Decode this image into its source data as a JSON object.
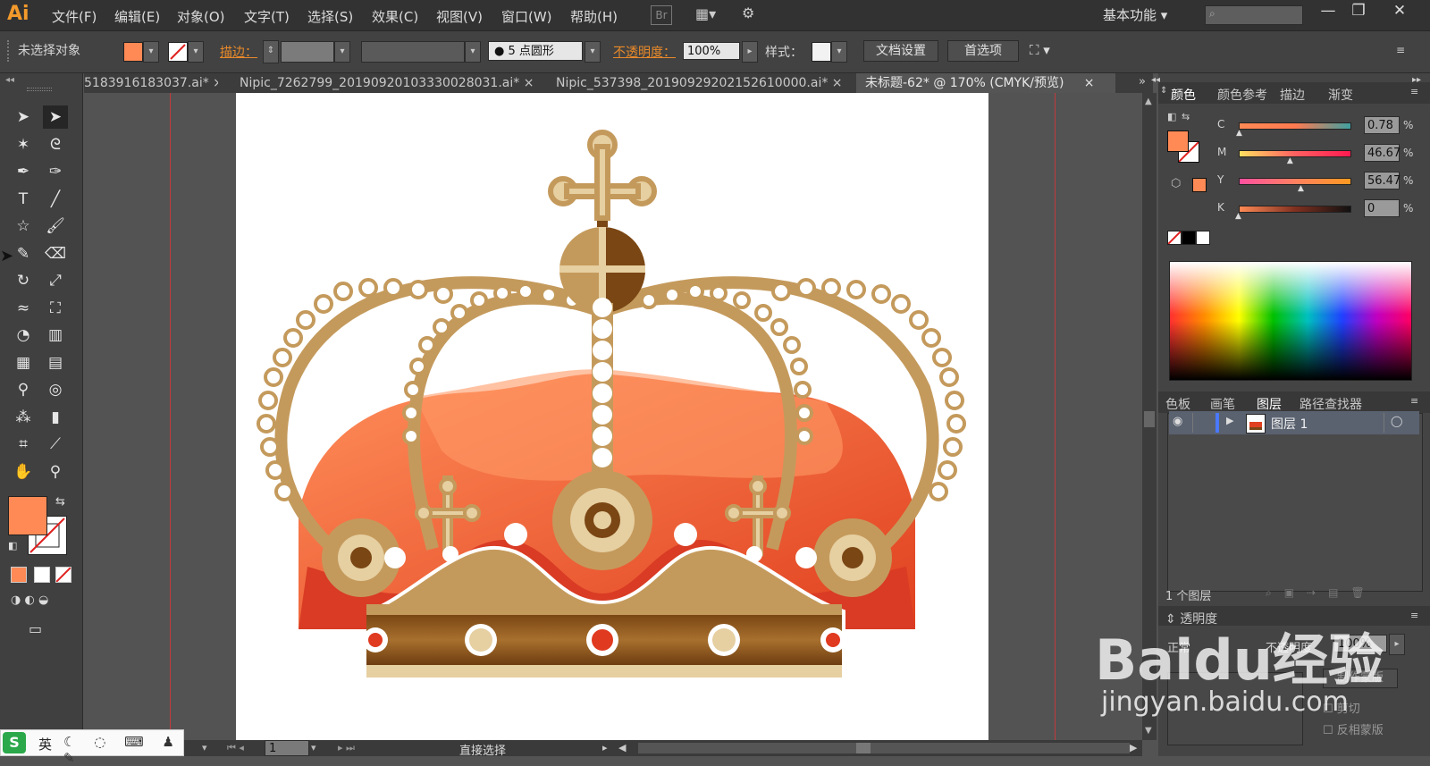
{
  "app": {
    "logo": "Ai",
    "workspace": "基本功能",
    "bridge": "Br"
  },
  "menu": [
    "文件(F)",
    "编辑(E)",
    "对象(O)",
    "文字(T)",
    "选择(S)",
    "效果(C)",
    "视图(V)",
    "窗口(W)",
    "帮助(H)"
  ],
  "controlbar": {
    "selection_label": "未选择对象",
    "stroke_label": "描边：",
    "brush_label": "5 点圆形",
    "opacity_label": "不透明度：",
    "opacity_value": "100%",
    "style_label": "样式：",
    "doc_setup": "文档设置",
    "prefs": "首选项"
  },
  "tabs": [
    {
      "label": "5183916183037.ai*",
      "close": "×"
    },
    {
      "label": "Nipic_7262799_20190920103330028031.ai*",
      "close": "×"
    },
    {
      "label": "Nipic_537398_20190929202152610000.ai*",
      "close": "×"
    },
    {
      "label": "未标题-62* @ 170% (CMYK/预览)",
      "close": "×"
    }
  ],
  "tools": [
    "select-icon",
    "direct-select-icon",
    "magic-wand-icon",
    "lasso-icon",
    "pen-icon",
    "curvature-icon",
    "type-icon",
    "line-icon",
    "star-icon",
    "brush-icon",
    "pencil-icon",
    "eraser-icon",
    "rotate-icon",
    "scale-icon",
    "warp-icon",
    "free-transform-icon",
    "shape-builder-icon",
    "perspective-icon",
    "mesh-icon",
    "gradient-icon",
    "eyedropper-icon",
    "blend-icon",
    "symbol-sprayer-icon",
    "graph-icon",
    "artboard-icon",
    "slice-icon",
    "hand-icon",
    "zoom-icon"
  ],
  "colors": {
    "fill": "#ff8a55",
    "accent_orange": "#f39a2c",
    "guide": "#c23b3b"
  },
  "color_panel": {
    "tabs": [
      "颜色",
      "颜色参考",
      "描边",
      "渐变"
    ],
    "channels": [
      {
        "label": "C",
        "value": "0.78",
        "unit": "%",
        "level": 0.008
      },
      {
        "label": "M",
        "value": "46.67",
        "unit": "%",
        "level": 0.4667
      },
      {
        "label": "Y",
        "value": "56.47",
        "unit": "%",
        "level": 0.5647
      },
      {
        "label": "K",
        "value": "0",
        "unit": "%",
        "level": 0
      }
    ]
  },
  "layers_panel": {
    "tabs": [
      "色板",
      "画笔",
      "图层",
      "路径查找器"
    ],
    "layer_name": "图层 1",
    "count": "1 个图层"
  },
  "transparency_panel": {
    "title": "透明度",
    "mode": "正常",
    "opacity_label": "不透明度",
    "opacity_value": "100%",
    "make_mask": "制作蒙版",
    "clip": "剪切",
    "invert": "反相蒙版"
  },
  "statusbar": {
    "page": "1",
    "tool": "直接选择"
  },
  "ime": {
    "lang": "英"
  },
  "watermark": {
    "brand": "Baidu经验",
    "url": "jingyan.baidu.com"
  }
}
